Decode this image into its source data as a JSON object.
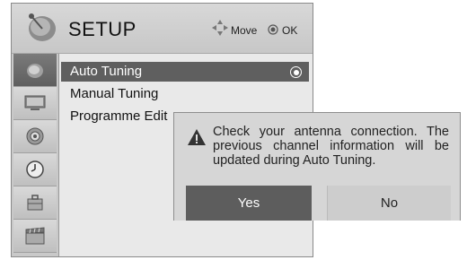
{
  "header": {
    "title": "SETUP",
    "hint_move": "Move",
    "hint_ok": "OK"
  },
  "sidebar": {
    "items": [
      {
        "icon": "satellite-dish-icon",
        "active": true
      },
      {
        "icon": "tv-picture-icon",
        "active": false
      },
      {
        "icon": "speaker-audio-icon",
        "active": false
      },
      {
        "icon": "clock-time-icon",
        "active": false
      },
      {
        "icon": "lock-briefcase-icon",
        "active": false
      },
      {
        "icon": "clapperboard-icon",
        "active": false
      }
    ]
  },
  "menu": {
    "items": [
      {
        "label": "Auto Tuning",
        "selected": true
      },
      {
        "label": "Manual Tuning",
        "selected": false
      },
      {
        "label": "Programme Edit",
        "selected": false
      }
    ]
  },
  "dialog": {
    "message": "Check your antenna connection. The previous channel information will be updated during Auto Tuning.",
    "yes_label": "Yes",
    "no_label": "No"
  }
}
